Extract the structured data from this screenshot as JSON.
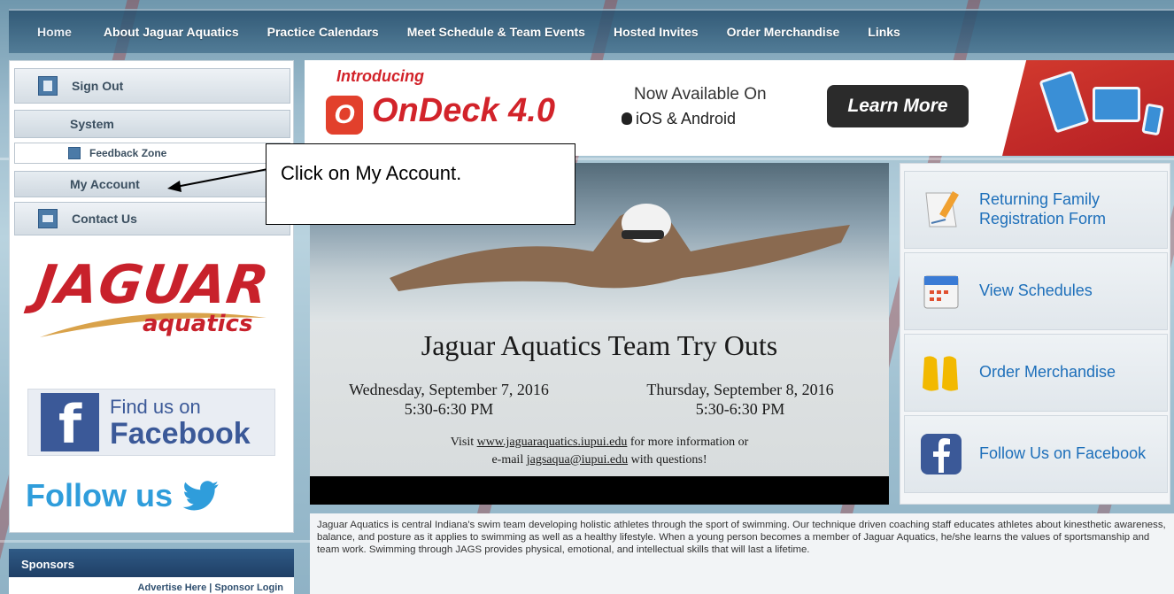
{
  "nav": {
    "items": [
      "Home",
      "About Jaguar Aquatics",
      "Practice Calendars",
      "Meet Schedule & Team Events",
      "Hosted Invites",
      "Order Merchandise",
      "Links"
    ]
  },
  "sidebar": {
    "menu": {
      "sign_out": "Sign Out",
      "system": "System",
      "feedback_zone": "Feedback Zone",
      "my_account": "My Account",
      "contact_us": "Contact Us"
    },
    "logo": {
      "jaguar": "JAGUAR",
      "aquatics": "aquatics"
    },
    "facebook": {
      "line1": "Find us on",
      "line2": "Facebook"
    },
    "follow_us": "Follow us"
  },
  "sponsors": {
    "header": "Sponsors",
    "links": "Advertise Here | Sponsor Login"
  },
  "banner": {
    "introducing": "Introducing",
    "product_icon": "O",
    "product": "OnDeck 4.0",
    "available": "Now Available On",
    "platforms": "iOS & Android",
    "learn_more": "Learn More"
  },
  "hero": {
    "title": "Jaguar Aquatics Team Try Outs",
    "date1": "Wednesday, September 7, 2016",
    "time1": "5:30-6:30 PM",
    "date2": "Thursday, September 8, 2016",
    "time2": "5:30-6:30 PM",
    "info_pre": "Visit ",
    "info_url": "www.jaguaraquatics.iupui.edu",
    "info_mid": " for more information or",
    "info_pre2": "e-mail ",
    "info_email": "jagsaqua@iupui.edu",
    "info_post": " with questions!"
  },
  "quick_links": [
    {
      "label": "Returning Family Registration Form",
      "icon": "form-pencil-icon"
    },
    {
      "label": "View Schedules",
      "icon": "calendar-icon"
    },
    {
      "label": "Order Merchandise",
      "icon": "swim-fins-icon"
    },
    {
      "label": "Follow Us on Facebook",
      "icon": "facebook-icon"
    }
  ],
  "description": "Jaguar Aquatics is central Indiana's swim team developing holistic athletes through the sport of swimming. Our technique driven coaching staff educates athletes about kinesthetic awareness, balance, and posture as it applies to swimming as well as a healthy lifestyle. When a young person becomes a member of Jaguar Aquatics, he/she learns the values of sportsmanship and team work. Swimming through JAGS provides physical, emotional, and intellectual skills that will last a lifetime.",
  "callout": {
    "text": "Click on My Account."
  },
  "colors": {
    "accent_red": "#d2232a",
    "link_blue": "#1d6fba",
    "facebook_blue": "#3b5998",
    "twitter_blue": "#2f9ddb",
    "nav_dark": "#2f5a86"
  }
}
